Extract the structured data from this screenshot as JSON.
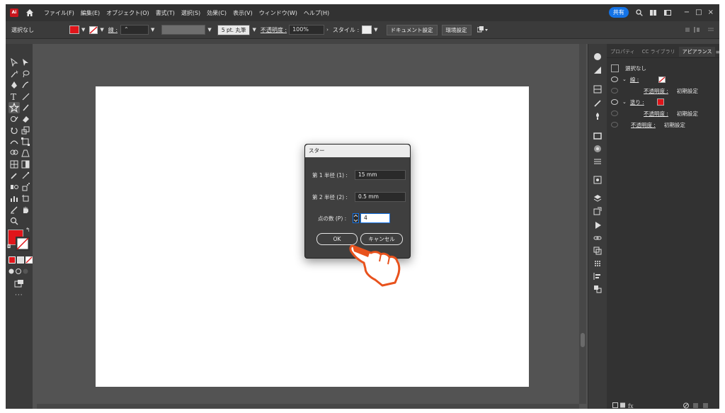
{
  "app": {
    "logo_text": "Ai"
  },
  "menu": [
    "ファイル(F)",
    "編集(E)",
    "オブジェクト(O)",
    "書式(T)",
    "選択(S)",
    "効果(C)",
    "表示(V)",
    "ウィンドウ(W)",
    "ヘルプ(H)"
  ],
  "top_right": {
    "share_label": "共有"
  },
  "control_bar": {
    "selection": "選択なし",
    "stroke_label": "線 :",
    "brush": "5 pt. 丸筆",
    "opacity_label": "不透明度 :",
    "opacity_value": "100%",
    "style_label": "スタイル :",
    "doc_setup": "ドキュメント設定",
    "prefs": "環境設定"
  },
  "colors": {
    "fill": "#e0151a",
    "accent": "#1473e6",
    "hand": "#e8521d"
  },
  "panel": {
    "tabs": [
      "プロパティ",
      "CC ライブラリ",
      "アピアランス"
    ],
    "header": "選択なし",
    "rows": [
      {
        "label": "線 :"
      },
      {
        "label": "不透明度 :",
        "value": "初期設定"
      },
      {
        "label": "塗り :"
      },
      {
        "label": "不透明度 :",
        "value": "初期設定"
      },
      {
        "label": "不透明度 :",
        "value": "初期設定"
      }
    ]
  },
  "dialog": {
    "title": "スター",
    "radius1_label": "第 1 半径 (1) :",
    "radius1_value": "15 mm",
    "radius2_label": "第 2 半径 (2) :",
    "radius2_value": "0.5 mm",
    "points_label": "点の数 (P) :",
    "points_value": "4",
    "ok_label": "OK",
    "cancel_label": "キャンセル"
  }
}
